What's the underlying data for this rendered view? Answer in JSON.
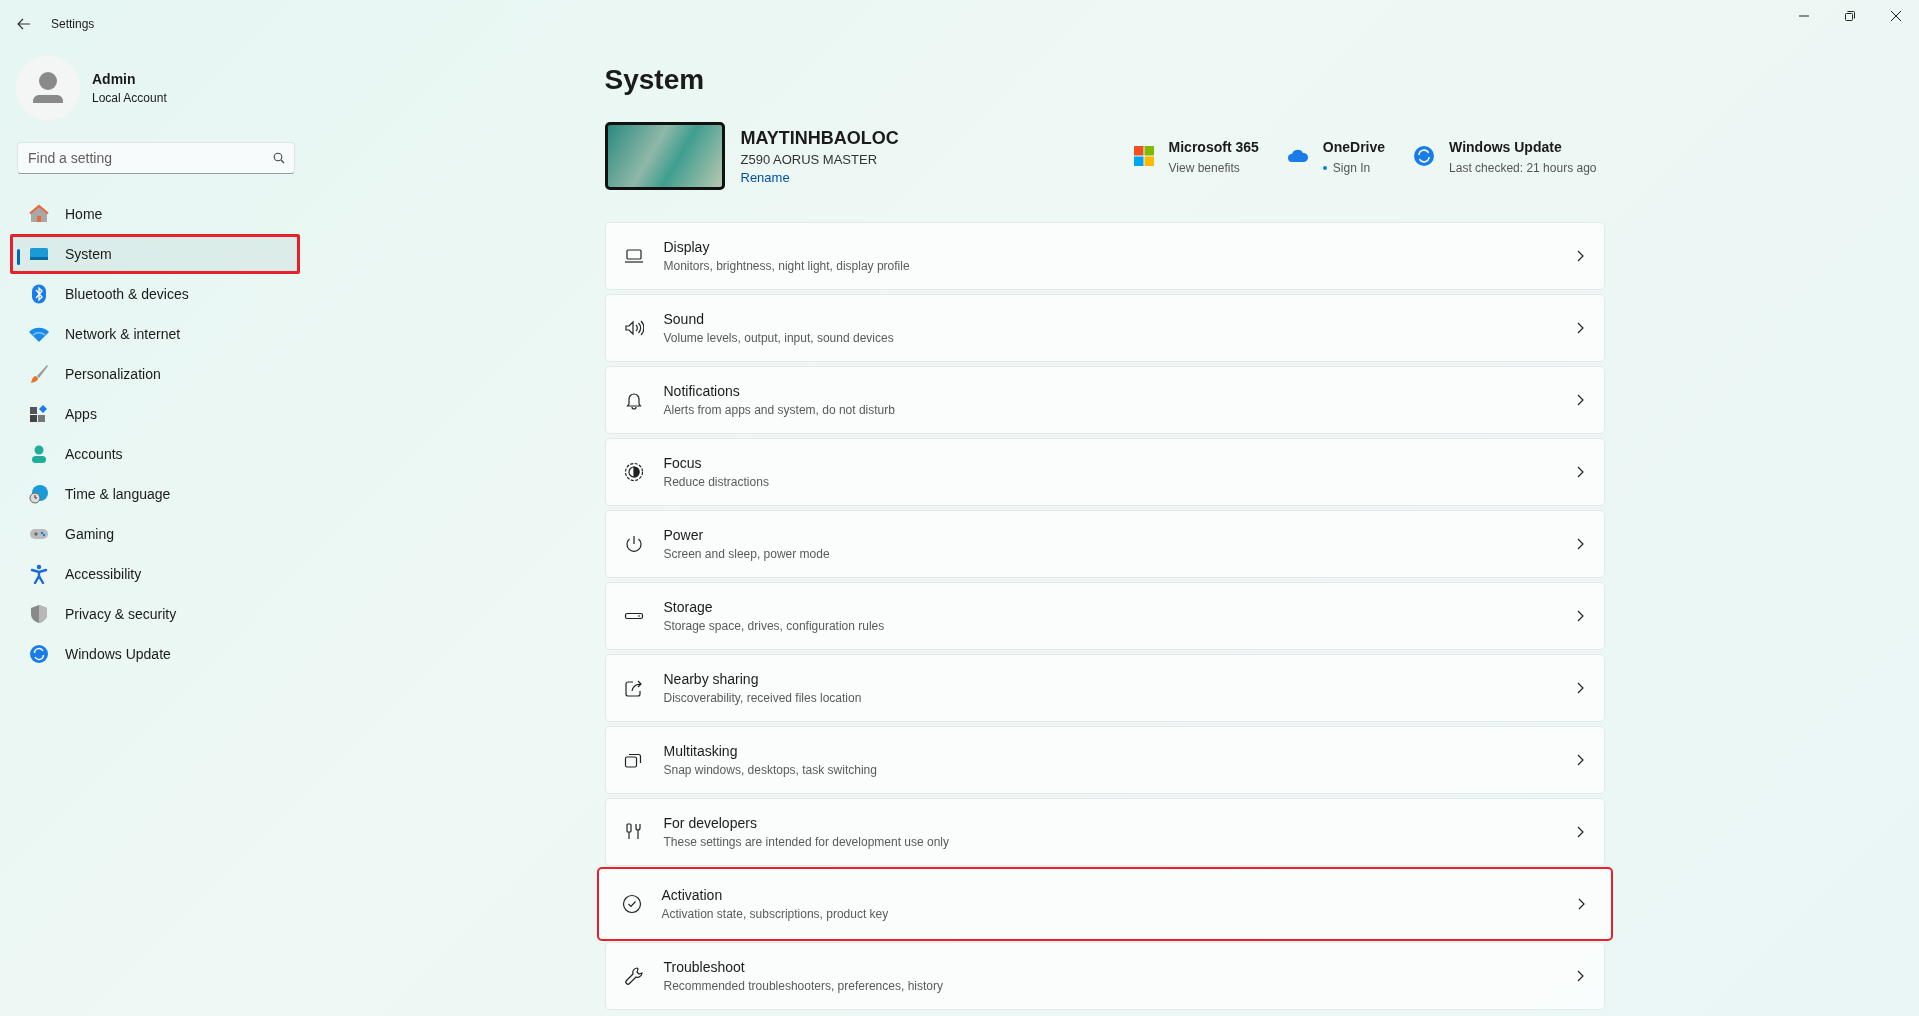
{
  "window": {
    "title": "Settings"
  },
  "account": {
    "name": "Admin",
    "type": "Local Account"
  },
  "search": {
    "placeholder": "Find a setting"
  },
  "sidebar": {
    "items": [
      {
        "label": "Home",
        "selected": false,
        "highlighted": false
      },
      {
        "label": "System",
        "selected": true,
        "highlighted": true
      },
      {
        "label": "Bluetooth & devices",
        "selected": false,
        "highlighted": false
      },
      {
        "label": "Network & internet",
        "selected": false,
        "highlighted": false
      },
      {
        "label": "Personalization",
        "selected": false,
        "highlighted": false
      },
      {
        "label": "Apps",
        "selected": false,
        "highlighted": false
      },
      {
        "label": "Accounts",
        "selected": false,
        "highlighted": false
      },
      {
        "label": "Time & language",
        "selected": false,
        "highlighted": false
      },
      {
        "label": "Gaming",
        "selected": false,
        "highlighted": false
      },
      {
        "label": "Accessibility",
        "selected": false,
        "highlighted": false
      },
      {
        "label": "Privacy & security",
        "selected": false,
        "highlighted": false
      },
      {
        "label": "Windows Update",
        "selected": false,
        "highlighted": false
      }
    ]
  },
  "page_title": "System",
  "device": {
    "name": "MAYTINHBAOLOC",
    "model": "Z590 AORUS MASTER",
    "rename": "Rename"
  },
  "quick_links": [
    {
      "title": "Microsoft 365",
      "subtitle": "View benefits",
      "bullet": false
    },
    {
      "title": "OneDrive",
      "subtitle": "Sign In",
      "bullet": true
    },
    {
      "title": "Windows Update",
      "subtitle": "Last checked: 21 hours ago",
      "bullet": false
    }
  ],
  "settings": [
    {
      "title": "Display",
      "description": "Monitors, brightness, night light, display profile",
      "highlighted": false
    },
    {
      "title": "Sound",
      "description": "Volume levels, output, input, sound devices",
      "highlighted": false
    },
    {
      "title": "Notifications",
      "description": "Alerts from apps and system, do not disturb",
      "highlighted": false
    },
    {
      "title": "Focus",
      "description": "Reduce distractions",
      "highlighted": false
    },
    {
      "title": "Power",
      "description": "Screen and sleep, power mode",
      "highlighted": false
    },
    {
      "title": "Storage",
      "description": "Storage space, drives, configuration rules",
      "highlighted": false
    },
    {
      "title": "Nearby sharing",
      "description": "Discoverability, received files location",
      "highlighted": false
    },
    {
      "title": "Multitasking",
      "description": "Snap windows, desktops, task switching",
      "highlighted": false
    },
    {
      "title": "For developers",
      "description": "These settings are intended for development use only",
      "highlighted": false
    },
    {
      "title": "Activation",
      "description": "Activation state, subscriptions, product key",
      "highlighted": true
    },
    {
      "title": "Troubleshoot",
      "description": "Recommended troubleshooters, preferences, history",
      "highlighted": false
    }
  ]
}
